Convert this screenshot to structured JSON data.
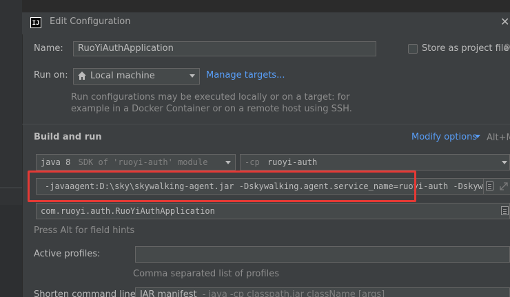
{
  "dialog": {
    "title": "Edit Configuration",
    "logo_text": "IJ",
    "close_glyph": "✕"
  },
  "name": {
    "label": "Name:",
    "value": "RuoYiAuthApplication",
    "store_label": "Store as project file"
  },
  "run_on": {
    "label": "Run on:",
    "value": "Local machine",
    "manage_link": "Manage targets...",
    "hint_line1": "Run configurations may be executed locally or on a target: for",
    "hint_line2": "example in a Docker Container or on a remote host using SSH."
  },
  "build_and_run": {
    "title": "Build and run",
    "modify_options": "Modify options",
    "modify_shortcut": "Alt+M",
    "jdk_value": "java 8",
    "jdk_hint": "SDK of 'ruoyi-auth' module",
    "cp_prefix": "-cp",
    "cp_value": "ruoyi-auth",
    "vm_options": "-javaagent:D:\\sky\\skywalking-agent.jar -Dskywalking.agent.service_name=ruoyi-auth -Dskywalki",
    "main_class": "com.ruoyi.auth.RuoYiAuthApplication",
    "field_hint": "Press Alt for field hints"
  },
  "active_profiles": {
    "label": "Active profiles:",
    "value": "",
    "hint": "Comma separated list of profiles"
  },
  "shorten": {
    "label": "Shorten command line:",
    "value": "JAR manifest",
    "detail": "- java -cp classpath.jar className [args]"
  },
  "icons": {
    "home": "home-icon",
    "chevron": "chevron-down-icon",
    "gear": "gear-icon",
    "expand": "expand-icon",
    "document": "document-icon"
  },
  "colors": {
    "accent_link": "#589df6",
    "highlight_box": "#e53935",
    "dialog_bg": "#3c3f41"
  }
}
